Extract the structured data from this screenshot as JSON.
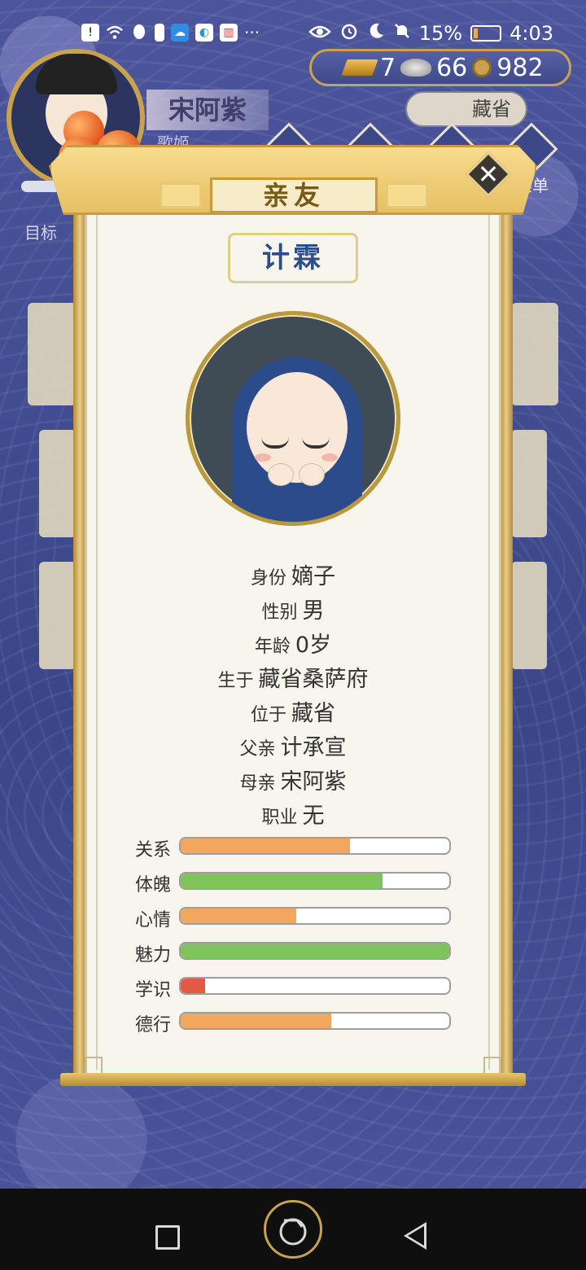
{
  "status_bar": {
    "battery": "15%",
    "battery_level": 0.15,
    "time": "4:03",
    "more": "···"
  },
  "hud": {
    "player_name": "宋阿紫",
    "player_role": "歌姬",
    "gold": "7",
    "silver": "66",
    "coins": "982",
    "location": "藏省",
    "menu_label": "菜单",
    "goal_label": "目标"
  },
  "modal": {
    "title": "亲友",
    "close": "✕",
    "name": "计霖",
    "info": [
      {
        "label": "身份",
        "value": "嫡子"
      },
      {
        "label": "性别",
        "value": "男"
      },
      {
        "label": "年龄",
        "value": "0岁"
      },
      {
        "label": "生于",
        "value": "藏省桑萨府"
      },
      {
        "label": "位于",
        "value": "藏省"
      },
      {
        "label": "父亲",
        "value": "计承宣"
      },
      {
        "label": "母亲",
        "value": "宋阿紫"
      },
      {
        "label": "职业",
        "value": "无"
      }
    ],
    "stats": [
      {
        "label": "关系",
        "level": 0.63,
        "color": "#f2a65e"
      },
      {
        "label": "体魄",
        "level": 0.75,
        "color": "#7ec45a"
      },
      {
        "label": "心情",
        "level": 0.43,
        "color": "#f2a65e"
      },
      {
        "label": "魅力",
        "level": 1.0,
        "color": "#7ec45a"
      },
      {
        "label": "学识",
        "level": 0.09,
        "color": "#e25a43"
      },
      {
        "label": "德行",
        "level": 0.56,
        "color": "#f2a65e"
      }
    ]
  },
  "icons": {
    "wifi": "wifi-icon",
    "eye": "eye-icon",
    "alarm": "alarm-icon",
    "moon": "moon-icon",
    "mute": "bell-off-icon"
  }
}
